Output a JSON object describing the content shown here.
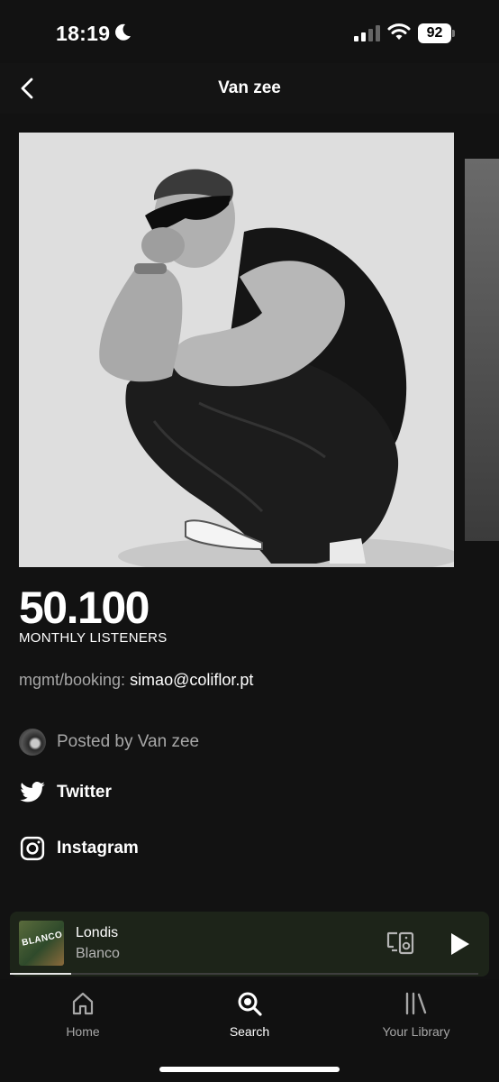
{
  "status_bar": {
    "time": "18:19",
    "battery": "92",
    "icons": [
      "moon-icon",
      "signal-icon",
      "wifi-icon",
      "battery-icon"
    ]
  },
  "header": {
    "title": "Van zee"
  },
  "artist": {
    "monthly_listeners": "50.100",
    "monthly_listeners_label": "MONTHLY LISTENERS",
    "bio_prefix": "mgmt/booking: ",
    "bio_email": "simao@coliflor.pt",
    "posted_by": "Posted by Van zee",
    "links": [
      {
        "label": "Twitter",
        "icon": "twitter-icon"
      },
      {
        "label": "Instagram",
        "icon": "instagram-icon"
      }
    ]
  },
  "now_playing": {
    "title": "Londis",
    "artist": "Blanco",
    "cover_text": "BLANCO",
    "progress": 0.13
  },
  "nav": {
    "items": [
      {
        "label": "Home",
        "icon": "home-icon"
      },
      {
        "label": "Search",
        "icon": "search-icon",
        "active": true
      },
      {
        "label": "Your Library",
        "icon": "library-icon"
      }
    ]
  },
  "colors": {
    "background": "#121212",
    "mini_player": "#1d2419",
    "muted_text": "#a7a7a7"
  }
}
